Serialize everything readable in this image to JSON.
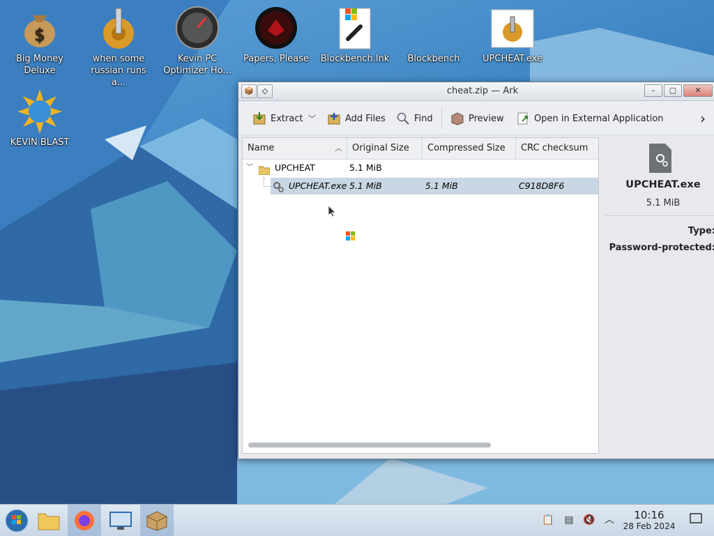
{
  "desktop": {
    "icons": [
      {
        "label": "Big Money Deluxe",
        "icon": "money-bag-icon"
      },
      {
        "label": "when some russian runs a...",
        "icon": "gear-knife-icon"
      },
      {
        "label": "Kevin PC Optimizer Ho...",
        "icon": "speedometer-icon"
      },
      {
        "label": "Papers, Please",
        "icon": "papers-please-icon"
      },
      {
        "label": "Blockbench.lnk",
        "icon": "shortcut-chain-icon"
      },
      {
        "label": "Blockbench",
        "icon": "blank-icon"
      },
      {
        "label": "UPCHEAT.exe",
        "icon": "upcheat-exe-icon"
      },
      {
        "label": "KEVIN BLAST",
        "icon": "sun-globe-icon"
      }
    ]
  },
  "window": {
    "title": "cheat.zip — Ark",
    "controls": {
      "minimize": "–",
      "maximize": "▢",
      "close": "✕"
    },
    "toolbar": {
      "extract": "Extract",
      "add_files": "Add Files",
      "find": "Find",
      "preview": "Preview",
      "open_external": "Open in External Application",
      "more": "›"
    },
    "columns": [
      "Name",
      "Original Size",
      "Compressed Size",
      "CRC checksum"
    ],
    "rows": [
      {
        "name": "UPCHEAT",
        "original": "5.1 MiB",
        "compressed": "",
        "crc": "",
        "type": "folder"
      },
      {
        "name": "UPCHEAT.exe",
        "original": "5.1 MiB",
        "compressed": "5.1 MiB",
        "crc": "C918D8F6",
        "type": "exe"
      }
    ],
    "info": {
      "name": "UPCHEAT.exe",
      "size": "5.1 MiB",
      "type_label": "Type:",
      "password_label": "Password-protected:"
    }
  },
  "taskbar": {
    "clock_time": "10:16",
    "clock_date": "28 Feb 2024"
  },
  "colors": {
    "selection": "#c9d6e3",
    "taskbar": "#d4e0ec"
  }
}
